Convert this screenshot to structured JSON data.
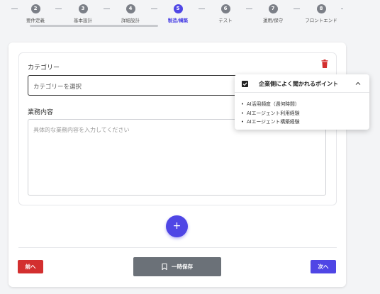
{
  "stepper": {
    "steps": [
      {
        "num": "2",
        "label": "要件定義"
      },
      {
        "num": "3",
        "label": "基本設計"
      },
      {
        "num": "4",
        "label": "詳細設計"
      },
      {
        "num": "5",
        "label": "製造/構築"
      },
      {
        "num": "6",
        "label": "テスト"
      },
      {
        "num": "7",
        "label": "運用/保守"
      },
      {
        "num": "8",
        "label": "フロントエンド"
      }
    ],
    "active_index": 3
  },
  "form": {
    "category_label": "カテゴリー",
    "category_placeholder": "カテゴリーを選択",
    "business_label": "業務内容",
    "business_placeholder": "具体的な業務内容を入力してください",
    "add_symbol": "+"
  },
  "footer": {
    "prev_label": "前へ",
    "save_label": "一時保存",
    "next_label": "次へ"
  },
  "popover": {
    "title": "企業側によく聞かれるポイント",
    "items": [
      "AI活用頻度（週何時間）",
      "AIエージェント利用経験",
      "AIエージェント構築経験"
    ]
  },
  "colors": {
    "accent": "#4f46e5",
    "danger": "#d32f2f",
    "save_button": "#6b7178",
    "step_inactive": "#7b7f87"
  }
}
